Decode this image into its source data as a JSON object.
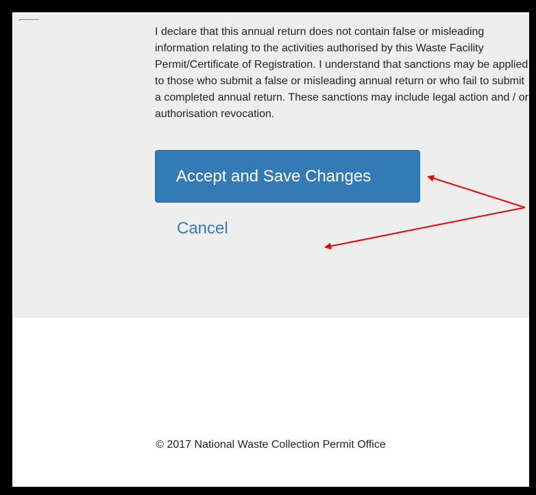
{
  "declaration": {
    "text": "I declare that this annual return does not contain false or misleading information relating to the activities authorised by this Waste Facility Permit/Certificate of Registration. I understand that sanctions may be applied to those who submit a false or misleading annual return or who fail to submit a completed annual return. These sanctions may include legal action and / or authorisation revocation."
  },
  "actions": {
    "accept_label": "Accept and Save Changes",
    "cancel_label": "Cancel"
  },
  "footer": {
    "copyright": "© 2017 National Waste Collection Permit Office"
  },
  "colors": {
    "primary": "#337ab7",
    "panel_bg": "#eeeeee",
    "annotation_arrow": "#ee0000"
  },
  "annotations": {
    "arrow_icon": "red-arrow-icon"
  }
}
